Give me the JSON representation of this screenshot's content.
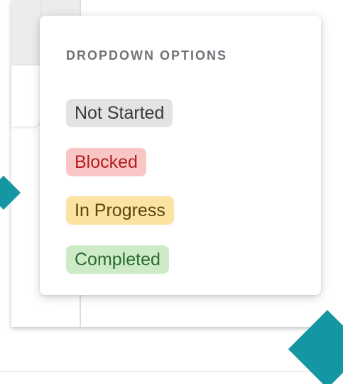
{
  "dropdown": {
    "title": "DROPDOWN OPTIONS",
    "options": [
      {
        "label": "Not Started",
        "bg": "#e3e3e3",
        "fg": "#3a3a3a"
      },
      {
        "label": "Blocked",
        "bg": "#f9c6c6",
        "fg": "#b51d1d"
      },
      {
        "label": "In Progress",
        "bg": "#fce3a1",
        "fg": "#5a4410"
      },
      {
        "label": "Completed",
        "bg": "#cdebc6",
        "fg": "#2b6b2f"
      }
    ]
  },
  "colors": {
    "accent": "#1496a3"
  }
}
